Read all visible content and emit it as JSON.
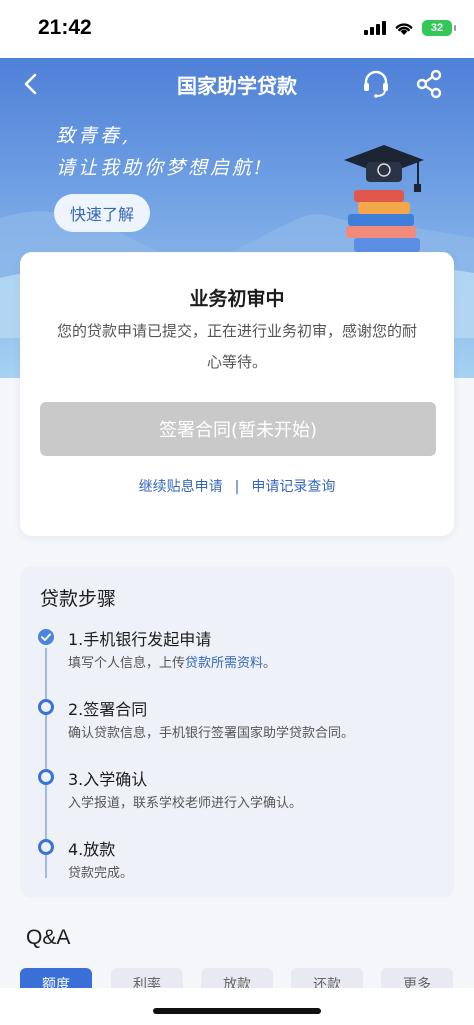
{
  "status_bar": {
    "time": "21:42",
    "battery": "32"
  },
  "nav": {
    "title": "国家助学贷款"
  },
  "hero": {
    "slogan_line1": "致青春,",
    "slogan_line2": "请让我助你梦想启航!",
    "learn_button": "快速了解"
  },
  "status_card": {
    "title": "业务初审中",
    "description": "您的贷款申请已提交，正在进行业务初审，感谢您的耐心等待。",
    "sign_button": "签署合同(暂未开始)",
    "link_continue": "继续贴息申请",
    "link_separator": "|",
    "link_records": "申请记录查询"
  },
  "steps": {
    "title": "贷款步骤",
    "items": [
      {
        "title": "1.手机银行发起申请",
        "desc_prefix": "填写个人信息，上传",
        "desc_highlight": "贷款所需资料",
        "desc_suffix": "。",
        "done": true
      },
      {
        "title": "2.签署合同",
        "desc": "确认贷款信息，手机银行签署国家助学贷款合同。",
        "done": false
      },
      {
        "title": "3.入学确认",
        "desc": "入学报道，联系学校老师进行入学确认。",
        "done": false
      },
      {
        "title": "4.放款",
        "desc": "贷款完成。",
        "done": false
      }
    ]
  },
  "qa": {
    "title": "Q&A",
    "tabs": [
      "额度",
      "利率",
      "放款",
      "还款",
      "更多"
    ],
    "active_tab": 0
  },
  "colors": {
    "primary": "#3a6fd8",
    "link": "#3567b8",
    "disabled_button": "#c9c9c9"
  }
}
